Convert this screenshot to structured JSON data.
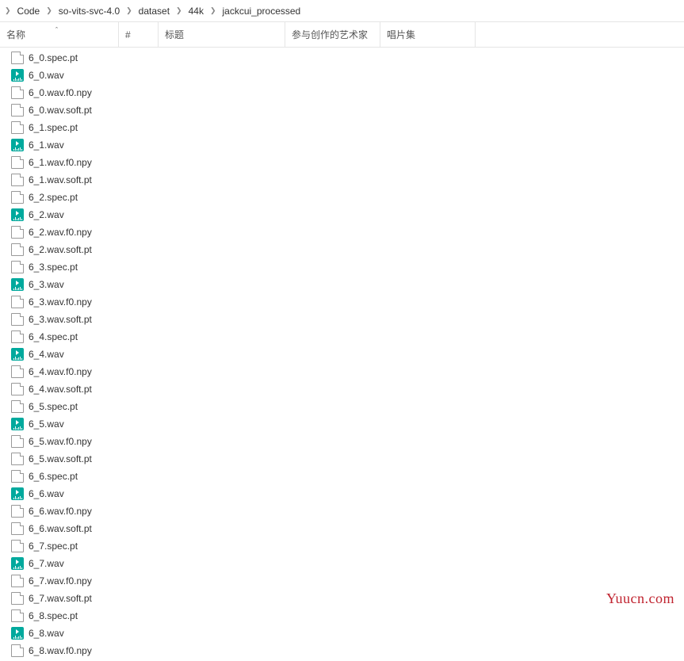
{
  "breadcrumb": [
    "Code",
    "so-vits-svc-4.0",
    "dataset",
    "44k",
    "jackcui_processed"
  ],
  "columns": {
    "name": "名称",
    "hash": "#",
    "title": "标题",
    "artist": "参与创作的艺术家",
    "album": "唱片集"
  },
  "files": [
    {
      "name": "6_0.spec.pt",
      "type": "doc"
    },
    {
      "name": "6_0.wav",
      "type": "wav"
    },
    {
      "name": "6_0.wav.f0.npy",
      "type": "doc"
    },
    {
      "name": "6_0.wav.soft.pt",
      "type": "doc"
    },
    {
      "name": "6_1.spec.pt",
      "type": "doc"
    },
    {
      "name": "6_1.wav",
      "type": "wav"
    },
    {
      "name": "6_1.wav.f0.npy",
      "type": "doc"
    },
    {
      "name": "6_1.wav.soft.pt",
      "type": "doc"
    },
    {
      "name": "6_2.spec.pt",
      "type": "doc"
    },
    {
      "name": "6_2.wav",
      "type": "wav"
    },
    {
      "name": "6_2.wav.f0.npy",
      "type": "doc"
    },
    {
      "name": "6_2.wav.soft.pt",
      "type": "doc"
    },
    {
      "name": "6_3.spec.pt",
      "type": "doc"
    },
    {
      "name": "6_3.wav",
      "type": "wav"
    },
    {
      "name": "6_3.wav.f0.npy",
      "type": "doc"
    },
    {
      "name": "6_3.wav.soft.pt",
      "type": "doc"
    },
    {
      "name": "6_4.spec.pt",
      "type": "doc"
    },
    {
      "name": "6_4.wav",
      "type": "wav"
    },
    {
      "name": "6_4.wav.f0.npy",
      "type": "doc"
    },
    {
      "name": "6_4.wav.soft.pt",
      "type": "doc"
    },
    {
      "name": "6_5.spec.pt",
      "type": "doc"
    },
    {
      "name": "6_5.wav",
      "type": "wav"
    },
    {
      "name": "6_5.wav.f0.npy",
      "type": "doc"
    },
    {
      "name": "6_5.wav.soft.pt",
      "type": "doc"
    },
    {
      "name": "6_6.spec.pt",
      "type": "doc"
    },
    {
      "name": "6_6.wav",
      "type": "wav"
    },
    {
      "name": "6_6.wav.f0.npy",
      "type": "doc"
    },
    {
      "name": "6_6.wav.soft.pt",
      "type": "doc"
    },
    {
      "name": "6_7.spec.pt",
      "type": "doc"
    },
    {
      "name": "6_7.wav",
      "type": "wav"
    },
    {
      "name": "6_7.wav.f0.npy",
      "type": "doc"
    },
    {
      "name": "6_7.wav.soft.pt",
      "type": "doc"
    },
    {
      "name": "6_8.spec.pt",
      "type": "doc"
    },
    {
      "name": "6_8.wav",
      "type": "wav"
    },
    {
      "name": "6_8.wav.f0.npy",
      "type": "doc"
    }
  ],
  "watermark": "Yuucn.com"
}
